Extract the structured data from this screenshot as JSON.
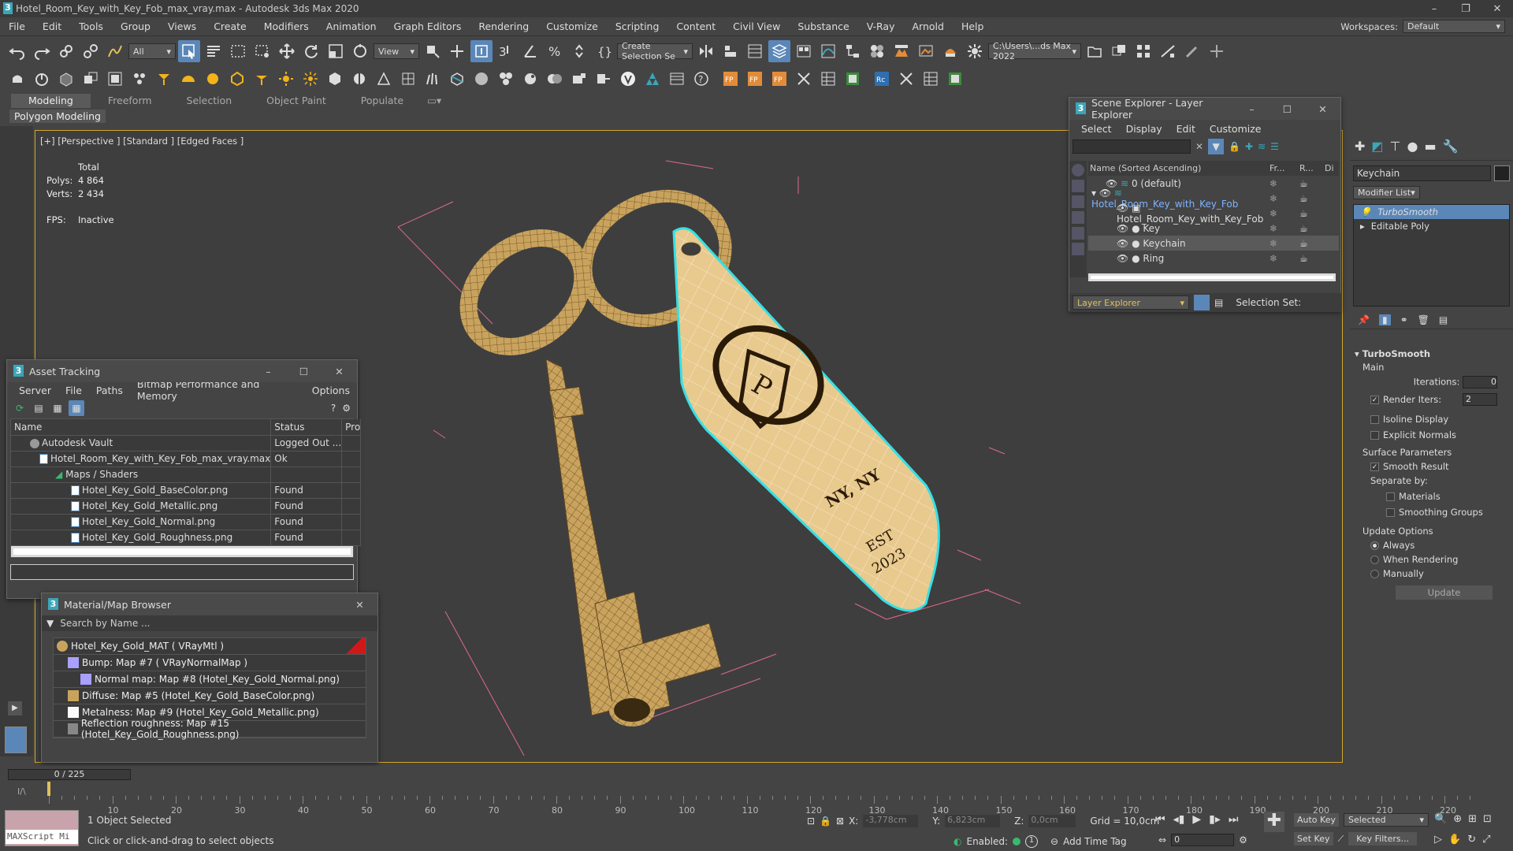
{
  "titlebar": {
    "title": "Hotel_Room_Key_with_Key_Fob_max_vray.max - Autodesk 3ds Max 2020"
  },
  "menu": {
    "items": [
      "File",
      "Edit",
      "Tools",
      "Group",
      "Views",
      "Create",
      "Modifiers",
      "Animation",
      "Graph Editors",
      "Rendering",
      "Customize",
      "Scripting",
      "Content",
      "Civil View",
      "Substance",
      "V-Ray",
      "Arnold",
      "Help"
    ],
    "workspaces_label": "Workspaces:",
    "workspaces_value": "Default"
  },
  "toolbar": {
    "filter": "All",
    "view": "View",
    "selection_set": "Create Selection Se",
    "path": "C:\\Users\\...ds Max 2022"
  },
  "ribbon": {
    "tabs": [
      "Modeling",
      "Freeform",
      "Selection",
      "Object Paint",
      "Populate"
    ],
    "sub": "Polygon Modeling"
  },
  "viewport": {
    "label": "[+] [Perspective ] [Standard ] [Edged Faces ]",
    "total": "Total",
    "polys_label": "Polys:",
    "polys": "4 864",
    "verts_label": "Verts:",
    "verts": "2 434",
    "fps_label": "FPS:",
    "fps": "Inactive",
    "fob_text1": "NY, NY",
    "fob_text2": "EST",
    "fob_text3": "2023"
  },
  "scene_explorer": {
    "title": "Scene Explorer - Layer Explorer",
    "menu": [
      "Select",
      "Display",
      "Edit",
      "Customize"
    ],
    "col_name": "Name (Sorted Ascending)",
    "col_fr": "Fr...",
    "col_r": "R...",
    "col_di": "Di",
    "rows": [
      "0 (default)",
      "Hotel_Room_Key_with_Key_Fob",
      "Hotel_Room_Key_with_Key_Fob",
      "Key",
      "Keychain",
      "Ring"
    ],
    "footer_dropdown": "Layer Explorer",
    "selection_set": "Selection Set:"
  },
  "asset_tracking": {
    "title": "Asset Tracking",
    "menu": [
      "Server",
      "File",
      "Paths",
      "Bitmap Performance and Memory",
      "Options"
    ],
    "headers": [
      "Name",
      "Status",
      "Pro"
    ],
    "rows": [
      {
        "name": "Autodesk Vault",
        "status": "Logged Out ..."
      },
      {
        "name": "Hotel_Room_Key_with_Key_Fob_max_vray.max",
        "status": "Ok"
      },
      {
        "name": "Maps / Shaders",
        "status": ""
      },
      {
        "name": "Hotel_Key_Gold_BaseColor.png",
        "status": "Found"
      },
      {
        "name": "Hotel_Key_Gold_Metallic.png",
        "status": "Found"
      },
      {
        "name": "Hotel_Key_Gold_Normal.png",
        "status": "Found"
      },
      {
        "name": "Hotel_Key_Gold_Roughness.png",
        "status": "Found"
      }
    ]
  },
  "material_browser": {
    "title": "Material/Map Browser",
    "search_placeholder": "Search by Name ...",
    "rows": [
      "Hotel_Key_Gold_MAT  ( VRayMtl )",
      "Bump: Map #7  ( VRayNormalMap )",
      "Normal map: Map #8 (Hotel_Key_Gold_Normal.png)",
      "Diffuse: Map #5 (Hotel_Key_Gold_BaseColor.png)",
      "Metalness: Map #9 (Hotel_Key_Gold_Metallic.png)",
      "Reflection roughness: Map #15 (Hotel_Key_Gold_Roughness.png)"
    ]
  },
  "command_panel": {
    "object_name": "Keychain",
    "modifier_list": "Modifier List",
    "stack": [
      "TurboSmooth",
      "Editable Poly"
    ],
    "rollout_title": "TurboSmooth",
    "main": "Main",
    "iterations_label": "Iterations:",
    "iterations": "0",
    "render_iters_label": "Render Iters:",
    "render_iters": "2",
    "isoline": "Isoline Display",
    "explicit": "Explicit Normals",
    "surface_params": "Surface Parameters",
    "smooth_result": "Smooth Result",
    "separate_by": "Separate by:",
    "materials": "Materials",
    "smoothing_groups": "Smoothing Groups",
    "update_options": "Update Options",
    "always": "Always",
    "when_rendering": "When Rendering",
    "manually": "Manually",
    "update_button": "Update"
  },
  "timeline": {
    "frame": "0 / 225",
    "ticks": [
      "10",
      "20",
      "30",
      "40",
      "50",
      "60",
      "70",
      "80",
      "90",
      "100",
      "110",
      "120",
      "130",
      "140",
      "150",
      "160",
      "170",
      "180",
      "190",
      "200",
      "210",
      "220"
    ]
  },
  "status": {
    "maxscript": "MAXScript Mi",
    "selected": "1 Object Selected",
    "hint": "Click or click-and-drag to select objects",
    "x_label": "X:",
    "x": "-3,778cm",
    "y_label": "Y:",
    "y": "6,823cm",
    "z_label": "Z:",
    "z": "0,0cm",
    "grid": "Grid = 10,0cm",
    "enabled": "Enabled:",
    "add_time_tag": "Add Time Tag",
    "auto_key": "Auto Key",
    "selected_dd": "Selected",
    "set_key": "Set Key",
    "key_filters": "Key Filters...",
    "frame_field": "0"
  },
  "colors": {
    "accent": "#5b87b8",
    "viewport_border": "#d3a62a",
    "selection_cyan": "#35e0e6",
    "gold": "#c9a35d"
  }
}
